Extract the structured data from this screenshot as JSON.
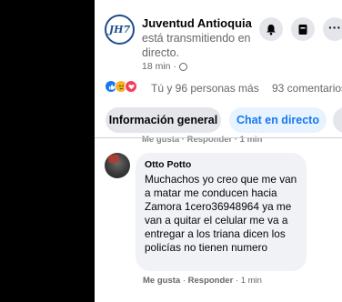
{
  "post": {
    "page_name": "Juventud Antioquia",
    "logo_text": "JH7",
    "live_status": "está transmitiendo en directo.",
    "time": "18 min",
    "reactions_text": "Tú y 96 personas más",
    "comments_count": "93 comentarios"
  },
  "tabs": {
    "info": "Información general",
    "chat": "Chat en directo"
  },
  "prev_comment": {
    "actions": "Me gusta · Responder · 1 min"
  },
  "comment": {
    "author": "Otto Potto",
    "text": "Muchachos yo creo que me van a matar me conducen hacia Zamora 1cero36948964 ya me van a quitar el celular me va a entregar a los triana dicen los policías no tienen numero",
    "like": "Me gusta",
    "reply": "Responder",
    "time": "1 min"
  }
}
